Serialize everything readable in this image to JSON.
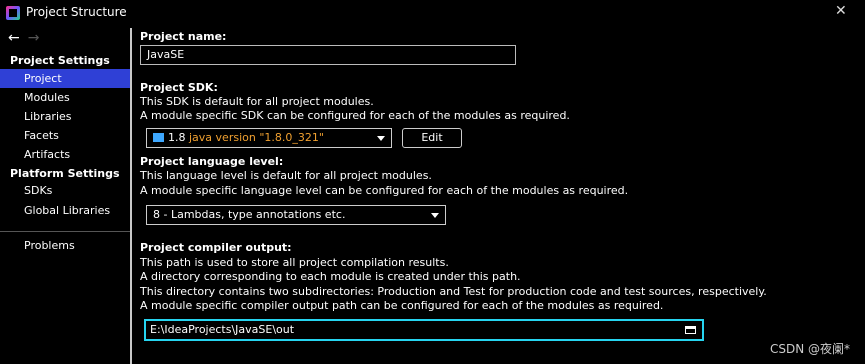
{
  "window": {
    "title": "Project Structure",
    "close_glyph": "✕"
  },
  "nav": {
    "back": "←",
    "forward": "→"
  },
  "sidebar": {
    "project_settings_title": "Project Settings",
    "project_items": [
      "Project",
      "Modules",
      "Libraries",
      "Facets",
      "Artifacts"
    ],
    "selected_item": "Project",
    "platform_settings_title": "Platform Settings",
    "platform_items": [
      "SDKs",
      "Global Libraries"
    ],
    "problems": "Problems"
  },
  "project_name": {
    "label": "Project name:",
    "value": "JavaSE"
  },
  "project_sdk": {
    "label": "Project SDK:",
    "desc1": "This SDK is default for all project modules.",
    "desc2": "A module specific SDK can be configured for each of the modules as required.",
    "sdk_name": "1.8",
    "sdk_version": "java version \"1.8.0_321\"",
    "edit_label": "Edit"
  },
  "language_level": {
    "label": "Project language level:",
    "desc1": "This language level is default for all project modules.",
    "desc2": "A module specific language level can be configured for each of the modules as required.",
    "value": "8 - Lambdas, type annotations etc."
  },
  "compiler_output": {
    "label": "Project compiler output:",
    "desc1": "This path is used to store all project compilation results.",
    "desc2": "A directory corresponding to each module is created under this path.",
    "desc3": "This directory contains two subdirectories: Production and Test for production code and test sources, respectively.",
    "desc4": "A module specific compiler output path can be configured for each of the modules as required.",
    "value": "E:\\IdeaProjects\\JavaSE\\out"
  },
  "watermark": "CSDN @夜阑*",
  "colors": {
    "selection": "#2f40d6",
    "focus_border": "#26d4f0",
    "sdk_version": "#f0a030"
  }
}
